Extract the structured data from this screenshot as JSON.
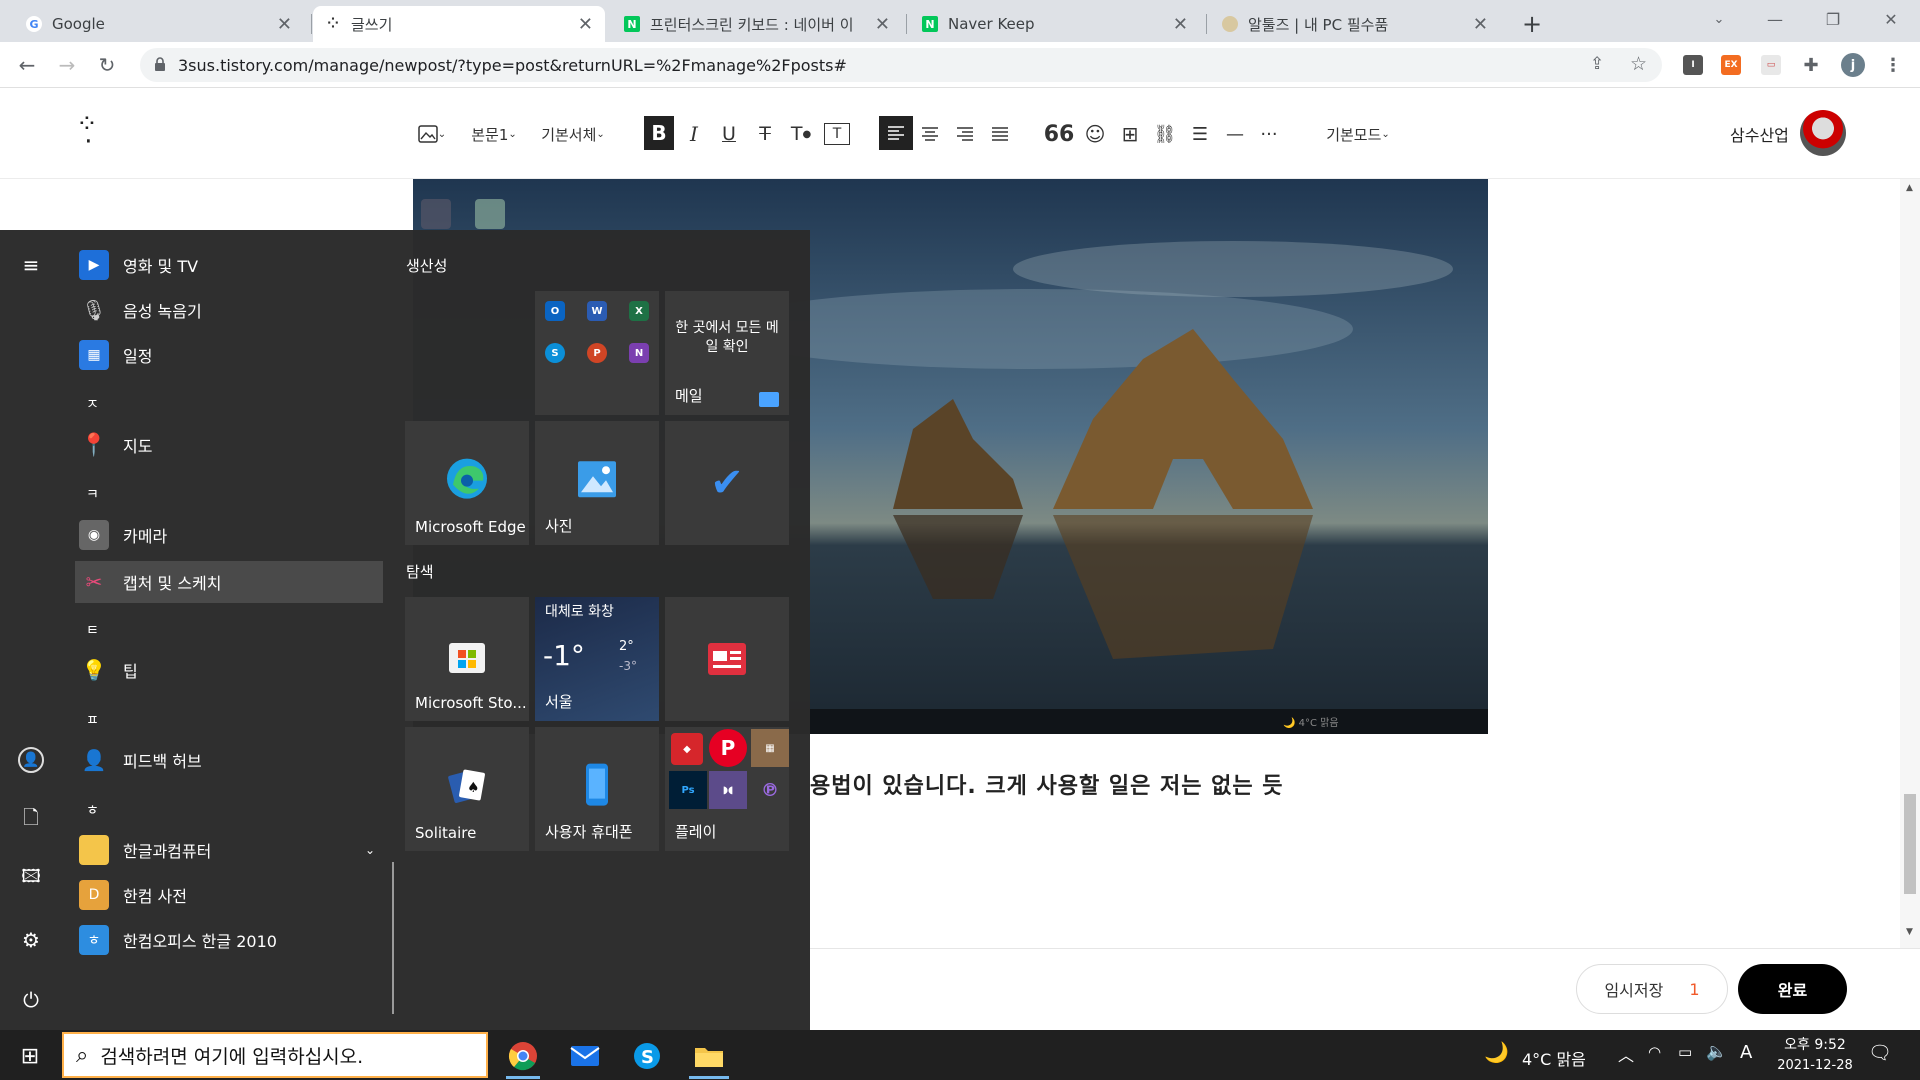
{
  "browser": {
    "tabs": [
      {
        "title": "Google",
        "active": false
      },
      {
        "title": "글쓰기",
        "active": true
      },
      {
        "title": "프린터스크린 키보드 : 네이버 이",
        "active": false
      },
      {
        "title": "Naver Keep",
        "active": false
      },
      {
        "title": "알툴즈 | 내 PC 필수품",
        "active": false
      }
    ],
    "url": "3sus.tistory.com/manage/newpost/?type=post&returnURL=%2Fmanage%2Fposts#",
    "profile_initial": "j"
  },
  "editor": {
    "toolbar": {
      "paragraph_style": "본문1",
      "font_family": "기본서체",
      "mode": "기본모드"
    },
    "blog_name": "삼수산업",
    "body_text": "용법이 있습니다. 크게 사용할 일은 저는 없는 듯",
    "temp_save_label": "임시저장",
    "temp_save_count": "1",
    "publish_label": "완료"
  },
  "start_menu": {
    "apps": [
      {
        "label": "영화 및 TV",
        "icon": "movies-icon"
      },
      {
        "label": "음성 녹음기",
        "icon": "microphone-icon"
      },
      {
        "label": "일정",
        "icon": "calendar-icon"
      },
      {
        "letter": "ㅈ"
      },
      {
        "label": "지도",
        "icon": "map-pin-icon"
      },
      {
        "letter": "ㅋ"
      },
      {
        "label": "카메라",
        "icon": "camera-icon"
      },
      {
        "label": "캡처 및 스케치",
        "icon": "snip-icon",
        "selected": true
      },
      {
        "letter": "ㅌ"
      },
      {
        "label": "팁",
        "icon": "lightbulb-icon"
      },
      {
        "letter": "ㅍ"
      },
      {
        "label": "피드백 허브",
        "icon": "feedback-icon"
      },
      {
        "letter": "ㅎ"
      },
      {
        "label": "한글과컴퓨터",
        "icon": "folder-icon"
      },
      {
        "label": "한컴 사전",
        "icon": "dictionary-icon"
      },
      {
        "label": "한컴오피스 한글 2010",
        "icon": "hwp-icon"
      }
    ],
    "groups": {
      "productivity": "생산성",
      "explore": "탐색"
    },
    "tiles": {
      "mail_text": "한 곳에서 모든 메일 확인",
      "mail_label": "메일",
      "edge_label": "Microsoft Edge",
      "photos_label": "사진",
      "store_label": "Microsoft Sto...",
      "weather_condition": "대체로 화창",
      "weather_temp": "-1°",
      "weather_high": "2°",
      "weather_low": "-3°",
      "weather_city": "서울",
      "solitaire_label": "Solitaire",
      "phone_label": "사용자 휴대폰",
      "play_label": "플레이"
    }
  },
  "taskbar": {
    "search_placeholder": "검색하려면 여기에 입력하십시오.",
    "weather": "4°C 맑음",
    "ime": "A",
    "time": "오후 9:52",
    "date": "2021-12-28"
  },
  "colors": {
    "tab_strip": "#dee1e6",
    "start_bg": "#2b2b2b",
    "taskbar": "#202020",
    "accent_orange": "#f1592a",
    "search_border": "#ffb14a"
  }
}
